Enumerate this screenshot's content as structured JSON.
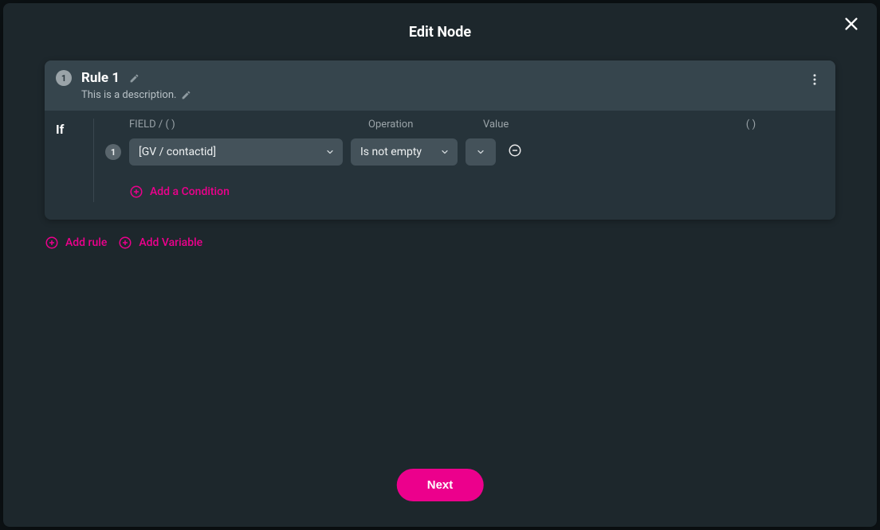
{
  "modal": {
    "title": "Edit Node",
    "next_label": "Next"
  },
  "rule": {
    "index": "1",
    "title": "Rule 1",
    "description": "This is a description.",
    "if_label": "If",
    "labels": {
      "field": "FIELD / ( )",
      "operation": "Operation",
      "value": "Value",
      "paren": "( )"
    },
    "conditions": [
      {
        "index": "1",
        "field": "[GV / contactid]",
        "operation": "Is not empty",
        "value": ""
      }
    ],
    "add_condition_label": "Add a Condition"
  },
  "actions": {
    "add_rule": "Add rule",
    "add_variable": "Add Variable"
  }
}
